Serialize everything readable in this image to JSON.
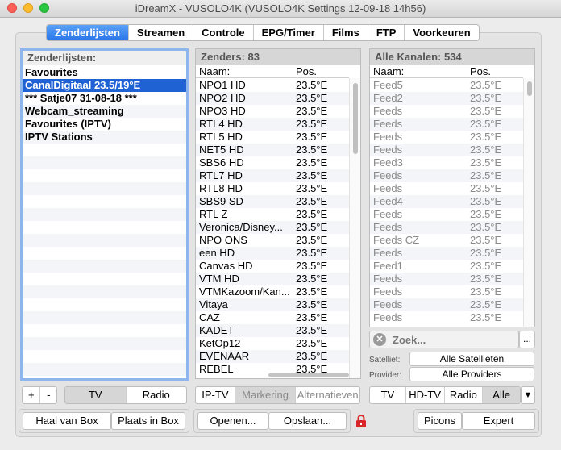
{
  "window": {
    "title": "iDreamX - VUSOLO4K (VUSOLO4K Settings 12-09-18 14h56)"
  },
  "tabs": [
    {
      "label": "Zenderlijsten",
      "active": true
    },
    {
      "label": "Streamen"
    },
    {
      "label": "Controle"
    },
    {
      "label": "EPG/Timer"
    },
    {
      "label": "Films"
    },
    {
      "label": "FTP"
    },
    {
      "label": "Voorkeuren"
    }
  ],
  "favorites": {
    "header": "Zenderlijsten:",
    "items": [
      "Favourites",
      "CanalDigitaal  23.5/19°E",
      "***  Satje07 31-08-18  ***",
      "Webcam_streaming",
      "Favourites  (IPTV)",
      "IPTV Stations"
    ],
    "selected_index": 1
  },
  "channels": {
    "header": "Zenders: 83",
    "col_name": "Naam:",
    "col_pos": "Pos.",
    "rows": [
      [
        "NPO1 HD",
        "23.5°E"
      ],
      [
        "NPO2 HD",
        "23.5°E"
      ],
      [
        "NPO3 HD",
        "23.5°E"
      ],
      [
        "RTL4 HD",
        "23.5°E"
      ],
      [
        "RTL5 HD",
        "23.5°E"
      ],
      [
        "NET5 HD",
        "23.5°E"
      ],
      [
        "SBS6 HD",
        "23.5°E"
      ],
      [
        "RTL7 HD",
        "23.5°E"
      ],
      [
        "RTL8 HD",
        "23.5°E"
      ],
      [
        "SBS9 SD",
        "23.5°E"
      ],
      [
        "RTL Z",
        "23.5°E"
      ],
      [
        "Veronica/Disney...",
        "23.5°E"
      ],
      [
        "NPO ONS",
        "23.5°E"
      ],
      [
        "een HD",
        "23.5°E"
      ],
      [
        "Canvas HD",
        "23.5°E"
      ],
      [
        "VTM HD",
        "23.5°E"
      ],
      [
        "VTMKazoom/Kan...",
        "23.5°E"
      ],
      [
        "Vitaya",
        "23.5°E"
      ],
      [
        "CAZ",
        "23.5°E"
      ],
      [
        "KADET",
        "23.5°E"
      ],
      [
        "KetOp12",
        "23.5°E"
      ],
      [
        "EVENAAR",
        "23.5°E"
      ],
      [
        "REBEL",
        "23.5°E"
      ]
    ]
  },
  "all_channels": {
    "header": "Alle Kanalen: 534",
    "col_name": "Naam:",
    "col_pos": "Pos.",
    "rows": [
      [
        "Feed5",
        "23.5°E"
      ],
      [
        "Feed2",
        "23.5°E"
      ],
      [
        "Feeds",
        "23.5°E"
      ],
      [
        "Feeds",
        "23.5°E"
      ],
      [
        "Feeds",
        "23.5°E"
      ],
      [
        "Feeds",
        "23.5°E"
      ],
      [
        "Feed3",
        "23.5°E"
      ],
      [
        "Feeds",
        "23.5°E"
      ],
      [
        "Feeds",
        "23.5°E"
      ],
      [
        "Feed4",
        "23.5°E"
      ],
      [
        "Feeds",
        "23.5°E"
      ],
      [
        "Feeds",
        "23.5°E"
      ],
      [
        "Feeds CZ",
        "23.5°E"
      ],
      [
        "Feeds",
        "23.5°E"
      ],
      [
        "Feed1",
        "23.5°E"
      ],
      [
        "Feeds",
        "23.5°E"
      ],
      [
        "Feeds",
        "23.5°E"
      ],
      [
        "Feeds",
        "23.5°E"
      ],
      [
        "Feeds",
        "23.5°E"
      ]
    ]
  },
  "search": {
    "placeholder": "Zoek...",
    "more_label": "..."
  },
  "filters": {
    "satellite_label": "Satelliet:",
    "satellite_value": "Alle Satellieten",
    "provider_label": "Provider:",
    "provider_value": "Alle Providers"
  },
  "fav_controls": {
    "add": "+",
    "remove": "-",
    "tv": "TV",
    "radio": "Radio"
  },
  "channel_controls": {
    "iptv": "IP-TV",
    "marking": "Markering",
    "alternatives": "Alternatieven"
  },
  "all_controls": {
    "tv": "TV",
    "hdtv": "HD-TV",
    "radio": "Radio",
    "all": "Alle",
    "dropdown": "▼"
  },
  "bottom": {
    "fetch_box": "Haal van Box",
    "place_box": "Plaats in Box",
    "open": "Openen...",
    "save": "Opslaan...",
    "picons": "Picons",
    "expert": "Expert"
  },
  "colors": {
    "accent": "#2a76e9",
    "selection": "#1f62d4",
    "lock": "#d9262b"
  }
}
